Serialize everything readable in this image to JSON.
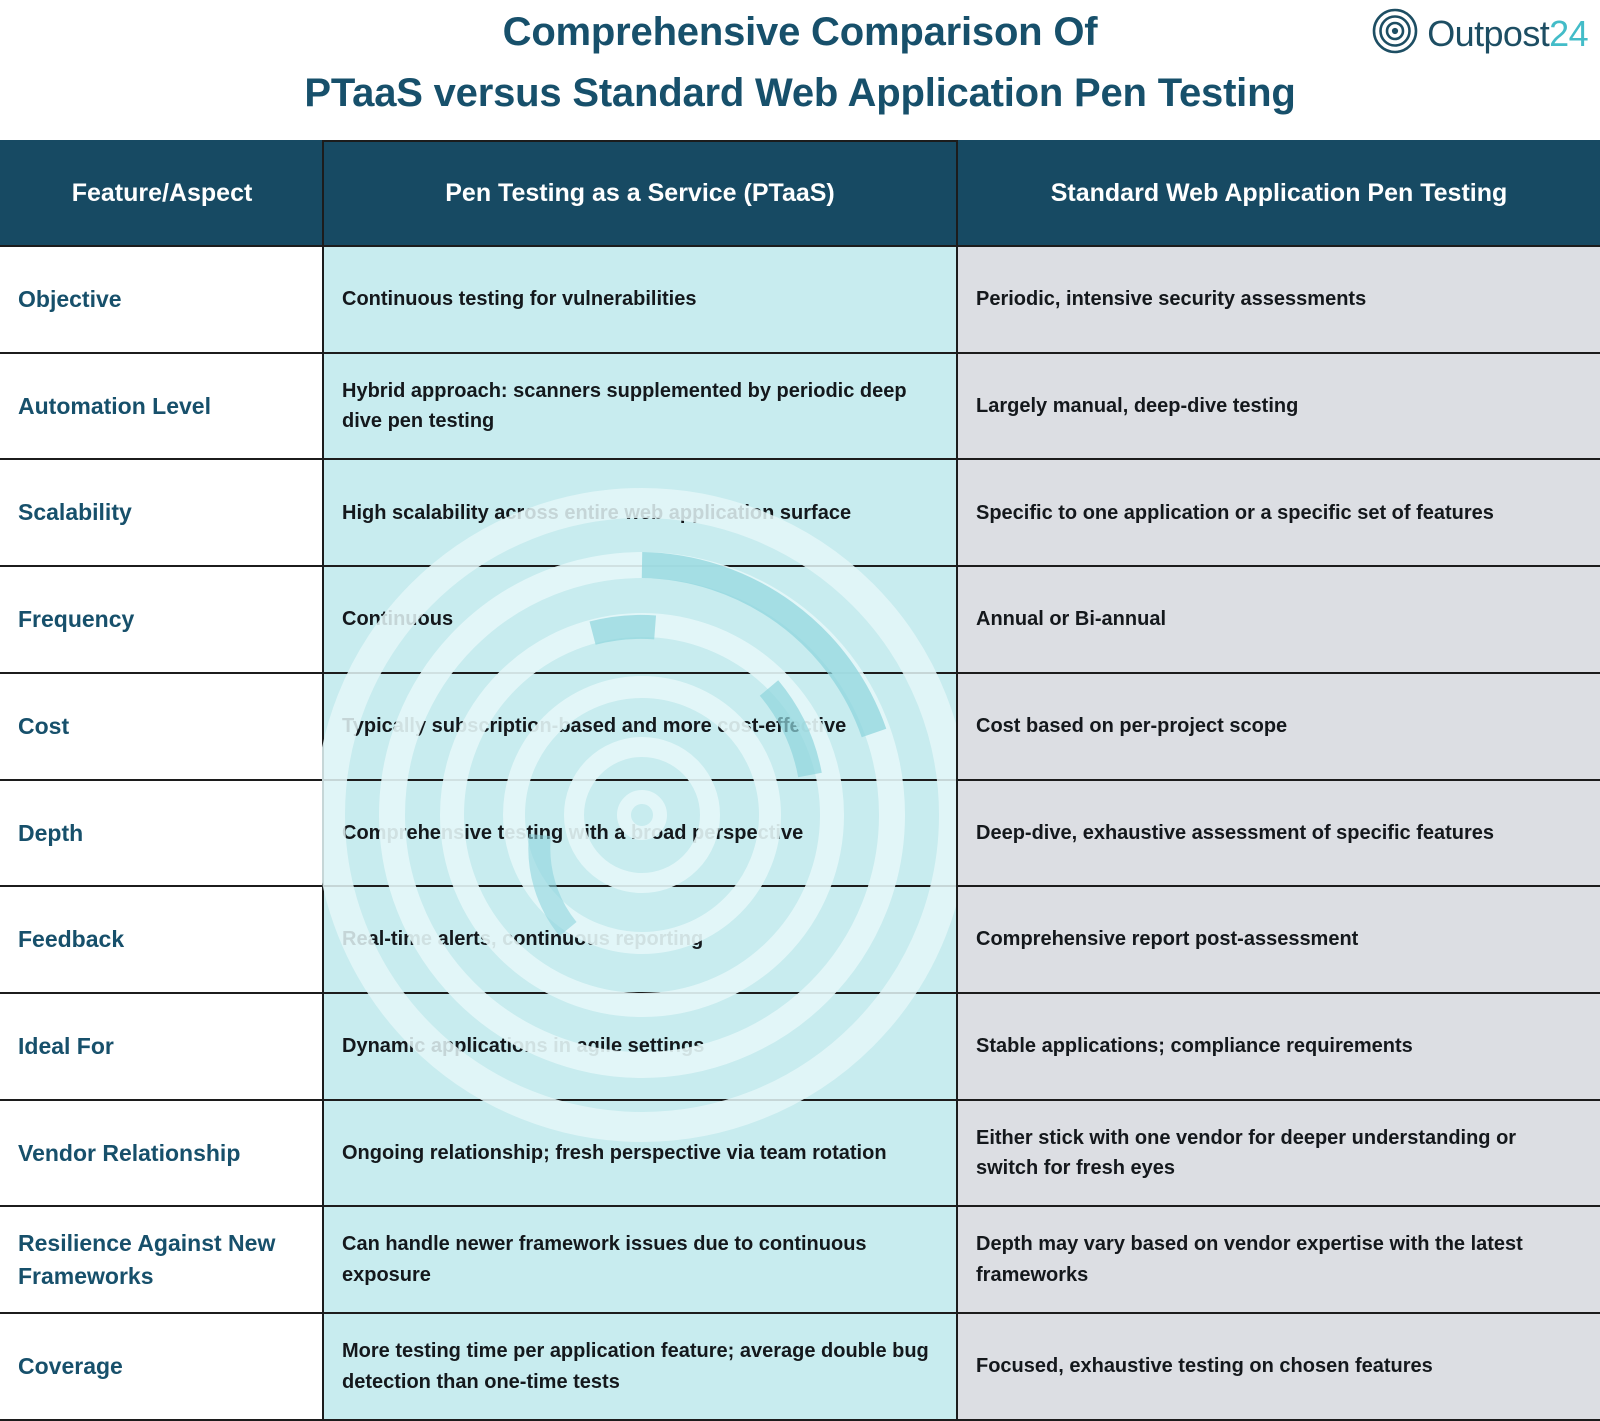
{
  "header": {
    "title_line_1": "Comprehensive Comparison Of",
    "title_line_2": "PTaaS versus Standard Web Application Pen Testing",
    "title_color": "#17506b",
    "logo": {
      "icon": "target-concentric-circles-icon",
      "brand": "Outpost",
      "number": "24",
      "brand_color": "#1d4e63",
      "number_color": "#43bcc8"
    }
  },
  "table": {
    "header_bg": "#174a63",
    "col_feature_bg": "#ffffff",
    "col_ptaas_bg": "#c8ecef",
    "col_standard_bg": "#dcdee3",
    "columns": [
      "Feature/Aspect",
      "Pen Testing as a Service (PTaaS)",
      "Standard Web Application Pen Testing"
    ],
    "rows": [
      {
        "feature": "Objective",
        "ptaas": "Continuous testing for vulnerabilities",
        "standard": "Periodic, intensive security assessments"
      },
      {
        "feature": "Automation Level",
        "ptaas": "Hybrid approach: scanners supplemented by periodic deep dive pen testing",
        "standard": "Largely manual, deep-dive testing"
      },
      {
        "feature": "Scalability",
        "ptaas": "High scalability across entire web application surface",
        "standard": "Specific to one application or a specific set of features"
      },
      {
        "feature": "Frequency",
        "ptaas": "Continuous",
        "standard": "Annual or Bi-annual"
      },
      {
        "feature": "Cost",
        "ptaas": "Typically subscription-based and more cost-effective",
        "standard": "Cost based on per-project scope"
      },
      {
        "feature": "Depth",
        "ptaas": "Comprehensive testing with a broad perspective",
        "standard": "Deep-dive, exhaustive assessment of specific features"
      },
      {
        "feature": "Feedback",
        "ptaas": "Real-time alerts, continuous reporting",
        "standard": "Comprehensive report post-assessment"
      },
      {
        "feature": "Ideal For",
        "ptaas": "Dynamic applications in agile settings",
        "standard": "Stable applications; compliance requirements"
      },
      {
        "feature": "Vendor Relationship",
        "ptaas": "Ongoing relationship; fresh perspective via team rotation",
        "standard": "Either stick with one vendor for deeper understanding or switch for fresh eyes"
      },
      {
        "feature": "Resilience Against New Frameworks",
        "ptaas": "Can handle newer framework issues due to continuous exposure",
        "standard": "Depth may vary based on vendor expertise with the latest frameworks"
      },
      {
        "feature": "Coverage",
        "ptaas": "More testing time per application feature; average double bug detection than one-time tests",
        "standard": "Focused, exhaustive testing on chosen features"
      }
    ]
  },
  "decoration": {
    "watermark": "radar-rings-watermark",
    "ring_color": "#e2f6f7",
    "arc_color": "#8fd6dd"
  }
}
